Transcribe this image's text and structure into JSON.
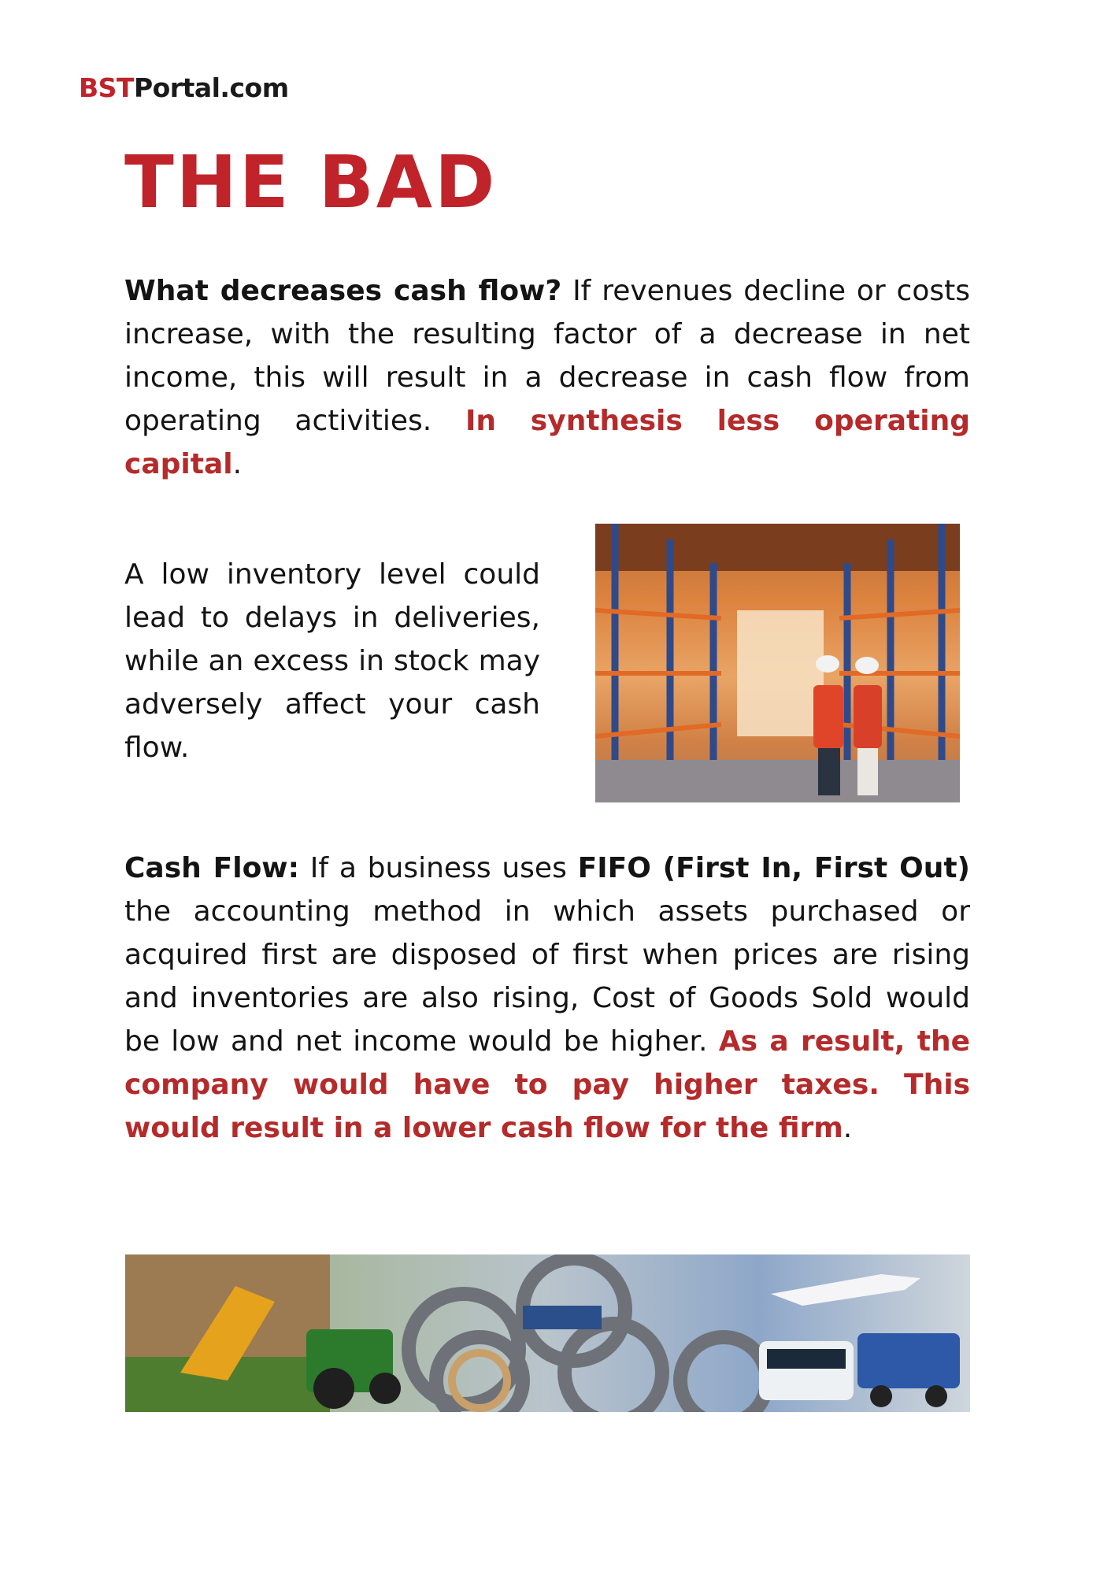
{
  "brand": {
    "accent": "BST",
    "rest": "Portal.com"
  },
  "title": "THE BAD",
  "para1": {
    "bold_lead": "What decreases cash flow?",
    "text": " If revenues decline or costs increase, with the resulting factor of a decrease in net income, this will result in a decrease in cash flow from operating activities. ",
    "highlight": "In synthesis less operating capital",
    "end": "."
  },
  "para2": {
    "text": "A low inventory level could lead to delays in deliveries, while an excess in stock may adversely affect your cash flow."
  },
  "para3": {
    "bold_lead": "Cash Flow:",
    "text_a": " If a business uses ",
    "bold_mid": "FIFO (First In, First Out)",
    "text_b": " the accounting method in which assets purchased or acquired first are disposed of first when prices are rising and inventories are also rising, Cost of Goods Sold would be low and net income would be higher. ",
    "highlight": "As a result, the company would have to pay higher taxes. This would result in a lower cash flow for the firm",
    "end": "."
  },
  "colors": {
    "accent": "#c0232a",
    "highlight": "#b52a2a",
    "text": "#141414"
  },
  "images": {
    "warehouse": "warehouse-workers-photo",
    "banner": "industrial-transport-bearings-banner"
  }
}
